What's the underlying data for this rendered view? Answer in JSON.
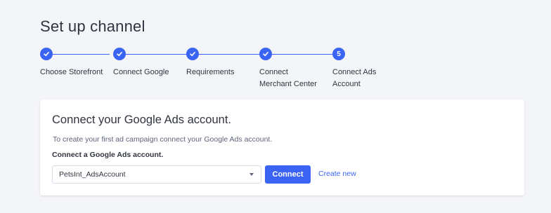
{
  "page": {
    "title": "Set up channel"
  },
  "stepper": {
    "steps": [
      {
        "label": "Choose Storefront",
        "status": "complete",
        "icon": "check-icon"
      },
      {
        "label": "Connect Google",
        "status": "complete",
        "icon": "check-icon"
      },
      {
        "label": "Requirements",
        "status": "complete",
        "icon": "check-icon"
      },
      {
        "label": "Connect\nMerchant Center",
        "status": "complete",
        "icon": "check-icon"
      },
      {
        "label": "Connect Ads\nAccount",
        "status": "current",
        "number": "5"
      }
    ],
    "accent_color": "#3c64f4"
  },
  "card": {
    "title": "Connect your Google Ads account.",
    "description": "To create your first ad campaign connect your Google Ads account.",
    "field_label": "Connect a Google Ads account.",
    "select_value": "PetsInt_AdsAccount",
    "connect_label": "Connect",
    "create_new_label": "Create new"
  }
}
